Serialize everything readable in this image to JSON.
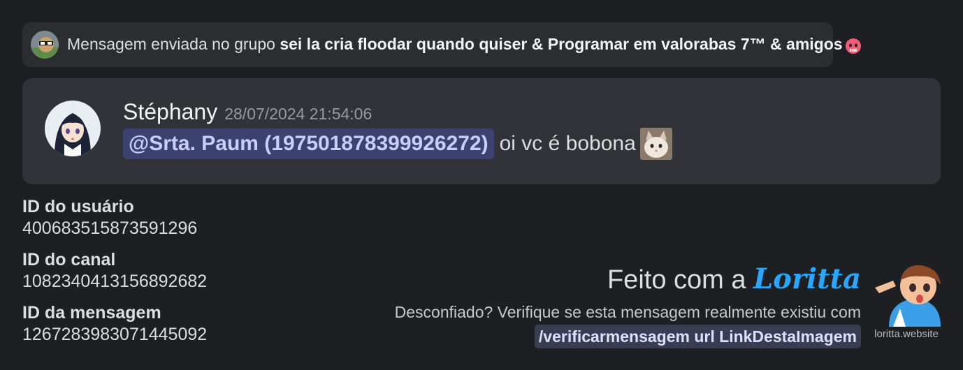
{
  "group_banner": {
    "prefix": "Mensagem enviada no grupo ",
    "group_name": "sei la cria floodar quando quiser & Programar em valorabas 7™ & amigos",
    "emoji_icon": "angry-devil-face-icon"
  },
  "message": {
    "author": "Stéphany",
    "timestamp": "28/07/2024 21:54:06",
    "mention": "@Srta. Paum (197501878399926272)",
    "text": "oi vc é bobona",
    "emoji_icon": "cat-emoji-icon"
  },
  "ids": [
    {
      "label": "ID do usuário",
      "value": "400683515873591296"
    },
    {
      "label": "ID do canal",
      "value": "1082340413156892682"
    },
    {
      "label": "ID da mensagem",
      "value": "1267283983071445092"
    }
  ],
  "footer": {
    "made_with": "Feito com a ",
    "brand": "Loritta",
    "verify_text": "Desconfiado? Verifique se esta mensagem realmente existiu com",
    "verify_command": "/verificarmensagem url LinkDestaImagem",
    "website": "loritta.website"
  },
  "colors": {
    "background": "#1e1f22",
    "banner": "#2b2d31",
    "card": "#313338",
    "mention_bg": "#3c4270",
    "brand": "#29a6fe"
  }
}
